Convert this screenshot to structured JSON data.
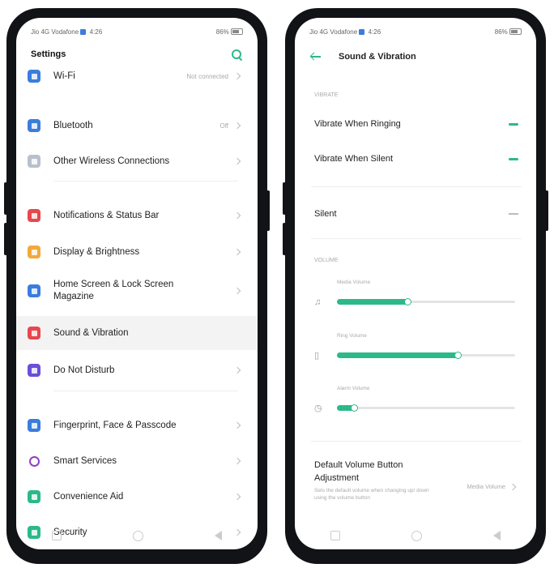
{
  "left_screen": {
    "status": {
      "carrier": "Jio 4G Vodafone",
      "time": "4:26",
      "battery": "86%"
    },
    "title": "Settings",
    "items": [
      {
        "label": "Wi-Fi",
        "value": "Not connected",
        "color": "#3b7ddd"
      },
      {
        "label": "Bluetooth",
        "value": "Off",
        "color": "#3b7ddd"
      },
      {
        "label": "Other Wireless Connections",
        "value": "",
        "color": "#b9c0cc"
      },
      {
        "label": "Notifications & Status Bar",
        "value": "",
        "color": "#e5484d"
      },
      {
        "label": "Display & Brightness",
        "value": "",
        "color": "#f2a93b"
      },
      {
        "label": "Home Screen & Lock Screen Magazine",
        "value": "",
        "color": "#3b7ddd"
      },
      {
        "label": "Sound & Vibration",
        "value": "",
        "color": "#e5484d"
      },
      {
        "label": "Do Not Disturb",
        "value": "",
        "color": "#6b4fd8"
      },
      {
        "label": "Fingerprint, Face & Passcode",
        "value": "",
        "color": "#3b7ddd"
      },
      {
        "label": "Smart Services",
        "value": "",
        "color": "#8e3fc9"
      },
      {
        "label": "Convenience Aid",
        "value": "",
        "color": "#2cb98a"
      },
      {
        "label": "Security",
        "value": "",
        "color": "#2cb98a"
      }
    ]
  },
  "right_screen": {
    "status": {
      "carrier": "Jio 4G Vodafone",
      "time": "4:26",
      "battery": "86%"
    },
    "title": "Sound & Vibration",
    "vibrate_section": "VIBRATE",
    "vibrate_ringing": "Vibrate When Ringing",
    "vibrate_silent": "Vibrate When Silent",
    "silent": "Silent",
    "volume_section": "VOLUME",
    "volumes": [
      {
        "label": "Media Volume",
        "icon": "♫",
        "level": 0.4
      },
      {
        "label": "Ring Volume",
        "icon": "▯",
        "level": 0.68
      },
      {
        "label": "Alarm Volume",
        "icon": "◷",
        "level": 0.1
      }
    ],
    "default_volume_title": "Default Volume Button Adjustment",
    "default_volume_desc": "Sets the default volume when changing up/ down using the volume button",
    "default_volume_value": "Media Volume"
  },
  "accent": "#2cb98a"
}
